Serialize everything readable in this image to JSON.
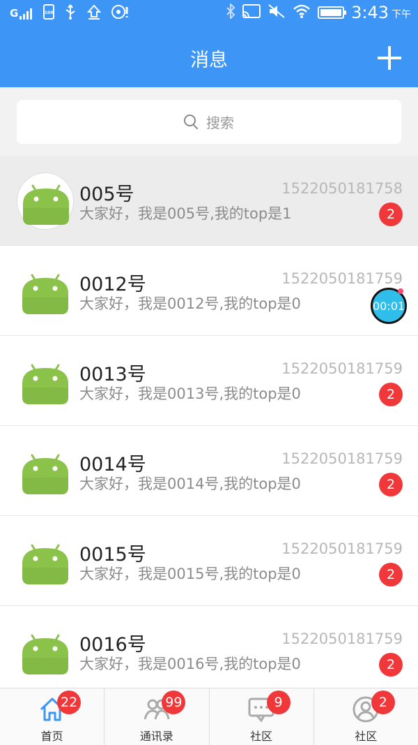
{
  "statusbar": {
    "time": "3:43",
    "ampm": "下午",
    "left_text": "G",
    "battery_label": "100"
  },
  "header": {
    "title": "消息"
  },
  "search": {
    "placeholder": "搜索"
  },
  "conversations": [
    {
      "name": "005号",
      "message": "大家好，我是005号,我的top是1",
      "time": "1522050181758",
      "badge": "2",
      "highlight": true
    },
    {
      "name": "0012号",
      "message": "大家好，我是0012号,我的top是0",
      "time": "1522050181759",
      "timer": "00:01"
    },
    {
      "name": "0013号",
      "message": "大家好，我是0013号,我的top是0",
      "time": "1522050181759",
      "badge": "2"
    },
    {
      "name": "0014号",
      "message": "大家好，我是0014号,我的top是0",
      "time": "1522050181759",
      "badge": "2"
    },
    {
      "name": "0015号",
      "message": "大家好，我是0015号,我的top是0",
      "time": "1522050181759",
      "badge": "2"
    },
    {
      "name": "0016号",
      "message": "大家好，我是0016号,我的top是0",
      "time": "1522050181759",
      "badge": "2"
    }
  ],
  "tabs": [
    {
      "label": "首页",
      "badge": "22",
      "icon": "home-icon",
      "color": "#3d95f5"
    },
    {
      "label": "通讯录",
      "badge": "99",
      "icon": "contacts-icon",
      "color": "#aaaaaa"
    },
    {
      "label": "社区",
      "badge": "9",
      "icon": "chat-icon",
      "color": "#aaaaaa"
    },
    {
      "label": "社区",
      "badge": "2",
      "icon": "profile-icon",
      "color": "#aaaaaa"
    }
  ],
  "colors": {
    "primary": "#3d95f5",
    "badge": "#f0383b",
    "android_green": "#8bc34a"
  }
}
